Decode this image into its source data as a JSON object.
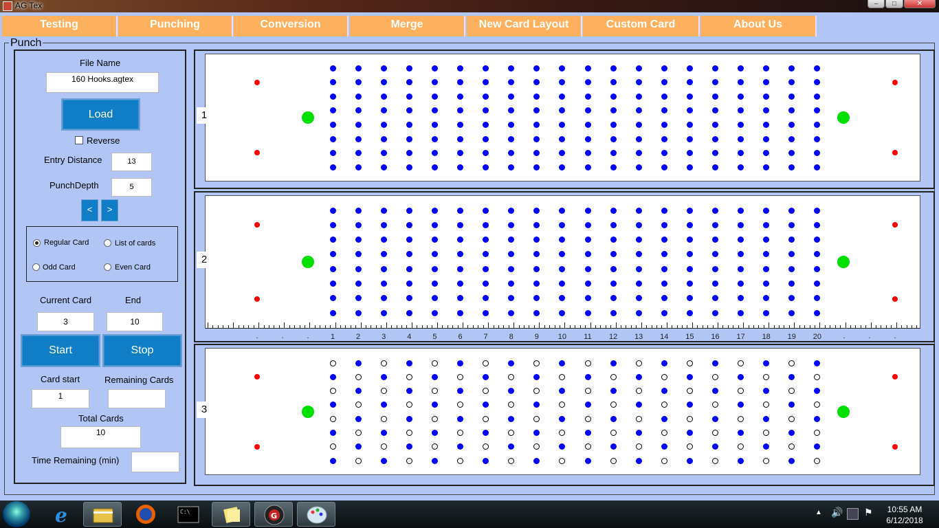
{
  "window": {
    "title": "AG Tex",
    "controls": {
      "minimize": "–",
      "maximize": "□",
      "close": "✕"
    }
  },
  "menu": [
    "Testing",
    "Punching",
    "Conversion",
    "Merge",
    "New Card Layout",
    "Custom Card",
    "About Us"
  ],
  "panel_title": "Punch",
  "left_panel": {
    "file_name_label": "File Name",
    "file_name_value": "160 Hooks.agtex",
    "load_button": "Load",
    "reverse_label": "Reverse",
    "reverse_checked": false,
    "entry_distance_label": "Entry Distance",
    "entry_distance_value": "13",
    "punch_depth_label": "PunchDepth",
    "punch_depth_value": "5",
    "prev_button": "<",
    "next_button": ">",
    "radio_options": [
      {
        "label": "Regular Card",
        "selected": true
      },
      {
        "label": "List of cards",
        "selected": false
      },
      {
        "label": "Odd Card",
        "selected": false
      },
      {
        "label": "Even Card",
        "selected": false
      }
    ],
    "current_card_label": "Current Card",
    "current_card_value": "3",
    "end_label": "End",
    "end_value": "10",
    "start_button": "Start",
    "stop_button": "Stop",
    "card_start_label": "Card start",
    "card_start_value": "1",
    "remaining_cards_label": "Remaining Cards",
    "remaining_cards_value": "",
    "total_cards_label": "Total Cards",
    "total_cards_value": "10",
    "time_remaining_label": "Time Remaining (min)",
    "time_remaining_value": ""
  },
  "cards": [
    {
      "number": "1",
      "columns": 20,
      "rows": 8,
      "pattern": "all"
    },
    {
      "number": "2",
      "columns": 20,
      "rows": 8,
      "pattern": "all",
      "ruler": true
    },
    {
      "number": "3",
      "columns": 20,
      "rows": 8,
      "pattern": "checker"
    }
  ],
  "ruler_labels": [
    "1",
    "2",
    "3",
    "4",
    "5",
    "6",
    "7",
    "8",
    "9",
    "10",
    "11",
    "12",
    "13",
    "14",
    "15",
    "16",
    "17",
    "18",
    "19",
    "20"
  ],
  "ruler_dots": [
    ".",
    ".",
    ".",
    ".",
    ".",
    "."
  ],
  "colors": {
    "background": "#b1c6f5",
    "menu": "#fdb15f",
    "button": "#0f7ec6",
    "hole": "#0000ff",
    "sync_dot": "#ff0000",
    "feed_dot": "#00e000"
  },
  "taskbar": {
    "icons": [
      "windows-start-icon",
      "internet-explorer-icon",
      "file-explorer-icon",
      "firefox-icon",
      "command-prompt-icon",
      "sticky-notes-icon",
      "agtex-app-icon",
      "paint-icon"
    ],
    "time": "10:55 AM",
    "date": "6/12/2018"
  }
}
